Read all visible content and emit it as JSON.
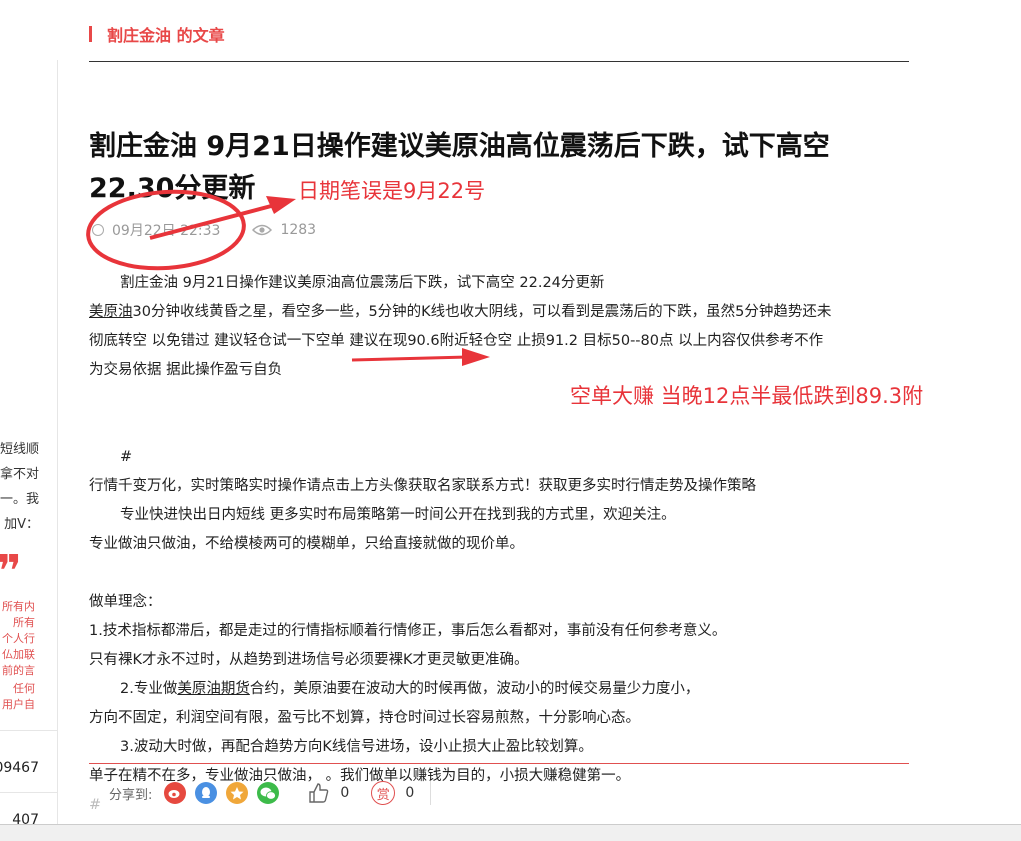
{
  "sidebar": {
    "lines": [
      "短线顺",
      "拿不对",
      "一。我",
      "加V："
    ],
    "red_lines": [
      "所有内",
      "所有",
      "个人行",
      "仏加联",
      "前的言",
      "任何",
      "用户自"
    ],
    "quote_mark": "❞",
    "number1": "09467",
    "number2": "407"
  },
  "header": {
    "author_articles": "割庄金油 的文章"
  },
  "article": {
    "title_line1": "割庄金油 9月21日操作建议美原油高位震荡后下跌，试下高空",
    "title_line2": " 22.30分更新",
    "date": "09月22日 22:33",
    "views": "1283"
  },
  "annotations": {
    "date_note": "日期笔误是9月22号",
    "result_note": "空单大赚  当晚12点半最低跌到89.3附"
  },
  "content": {
    "p1": "割庄金油 9月21日操作建议美原油高位震荡后下跌，试下高空  22.24分更新",
    "p2_link": "美原油",
    "p2_rest": "30分钟收线黄昏之星，看空多一些，5分钟的K线也收大阴线，可以看到是震荡后的下跌，虽然5分钟趋势还未",
    "p3": "彻底转空 以免错过  建议轻仓试一下空单  建议在现90.6附近轻仓空 止损91.2  目标50--80点  以上内容仅供参考不作",
    "p4": "为交易依据 据此操作盈亏自负",
    "hash": "#",
    "p5": "行情千变万化，实时策略实时操作请点击上方头像获取名家联系方式！获取更多实时行情走势及操作策略",
    "p6": "专业快进快出日内短线 更多实时布局策略第一时间公开在找到我的方式里，欢迎关注。",
    "p7": "专业做油只做油，不给模棱两可的模糊单，只给直接就做的现价单。",
    "p8": "做单理念：",
    "p9": "1.技术指标都滞后，都是走过的行情指标顺着行情修正，事后怎么看都对，事前没有任何参考意义。",
    "p10": "只有裸K才永不过时，从趋势到进场信号必须要裸K才更灵敏更准确。",
    "p11_a": "2.专业做",
    "p11_link": "美原油期货",
    "p11_b": "合约，美原油要在波动大的时候再做，波动小的时候交易量少力度小，",
    "p12": "方向不固定，利润空间有限，盈亏比不划算，持仓时间过长容易煎熬，十分影响心态。",
    "p13": "3.波动大时做，再配合趋势方向K线信号进场，设小止损大止盈比较划算。",
    "p14": "单子在精不在多，专业做油只做油，   。我们做单以赚钱为目的，小损大赚稳健第一。",
    "p15": "#"
  },
  "share": {
    "label": "分享到:",
    "likes": "0",
    "reward_icon_text": "赏",
    "rewards": "0"
  },
  "colors": {
    "accent": "#e84848",
    "annotation": "#e8343a"
  }
}
